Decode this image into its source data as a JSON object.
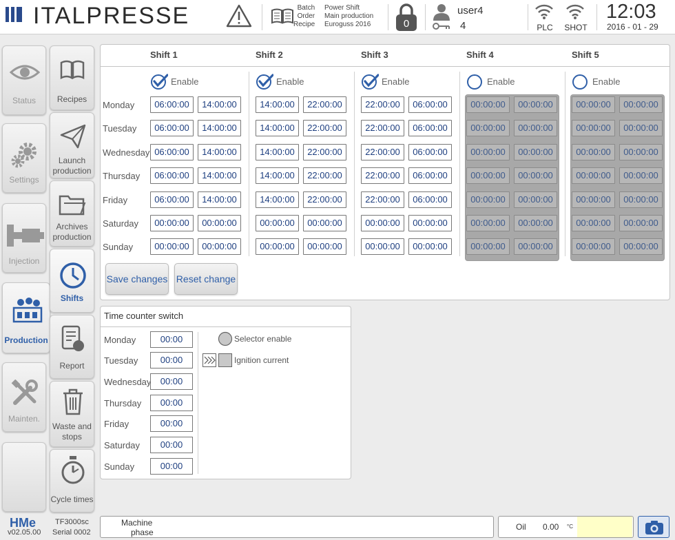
{
  "header": {
    "brand": "ITALPRESSE",
    "batch_label": "Batch",
    "batch_value": "Power Shift",
    "order_label": "Order",
    "order_value": "Main production",
    "recipe_label": "Recipe",
    "recipe_value": "Euroguss 2016",
    "lock_count": "0",
    "user_name": "user4",
    "user_level": "4",
    "plc_label": "PLC",
    "shot_label": "SHOT",
    "time": "12:03",
    "date": "2016 - 01 - 29"
  },
  "left_nav": [
    {
      "label": "Status",
      "icon": "eye-icon"
    },
    {
      "label": "Settings",
      "icon": "gears-icon"
    },
    {
      "label": "Injection",
      "icon": "injection-icon"
    },
    {
      "label": "Production",
      "icon": "factory-icon",
      "active": true
    },
    {
      "label": "Mainten.",
      "icon": "tools-icon"
    }
  ],
  "sub_nav": [
    {
      "label": "Recipes",
      "icon": "book-icon"
    },
    {
      "label": "Launch production",
      "label1": "Launch",
      "label2": "production",
      "icon": "paper-plane-icon"
    },
    {
      "label": "Archives production",
      "label1": "Archives",
      "label2": "production",
      "icon": "folder-icon"
    },
    {
      "label": "Shifts",
      "icon": "clock-icon",
      "active": true
    },
    {
      "label": "Report",
      "icon": "report-icon"
    },
    {
      "label": "Waste and stops",
      "label1": "Waste and",
      "label2": "stops",
      "icon": "trash-icon"
    },
    {
      "label": "Cycle times",
      "icon": "stopwatch-icon"
    }
  ],
  "shifts_table": {
    "enable_label": "Enable",
    "days": [
      "Monday",
      "Tuesday",
      "Wednesday",
      "Thursday",
      "Friday",
      "Saturday",
      "Sunday"
    ],
    "shifts": [
      {
        "name": "Shift 1",
        "enabled": true,
        "times": [
          [
            "06:00:00",
            "14:00:00"
          ],
          [
            "06:00:00",
            "14:00:00"
          ],
          [
            "06:00:00",
            "14:00:00"
          ],
          [
            "06:00:00",
            "14:00:00"
          ],
          [
            "06:00:00",
            "14:00:00"
          ],
          [
            "00:00:00",
            "00:00:00"
          ],
          [
            "00:00:00",
            "00:00:00"
          ]
        ]
      },
      {
        "name": "Shift 2",
        "enabled": true,
        "times": [
          [
            "14:00:00",
            "22:00:00"
          ],
          [
            "14:00:00",
            "22:00:00"
          ],
          [
            "14:00:00",
            "22:00:00"
          ],
          [
            "14:00:00",
            "22:00:00"
          ],
          [
            "14:00:00",
            "22:00:00"
          ],
          [
            "00:00:00",
            "00:00:00"
          ],
          [
            "00:00:00",
            "00:00:00"
          ]
        ]
      },
      {
        "name": "Shift 3",
        "enabled": true,
        "times": [
          [
            "22:00:00",
            "06:00:00"
          ],
          [
            "22:00:00",
            "06:00:00"
          ],
          [
            "22:00:00",
            "06:00:00"
          ],
          [
            "22:00:00",
            "06:00:00"
          ],
          [
            "22:00:00",
            "06:00:00"
          ],
          [
            "00:00:00",
            "00:00:00"
          ],
          [
            "00:00:00",
            "00:00:00"
          ]
        ]
      },
      {
        "name": "Shift 4",
        "enabled": false,
        "times": [
          [
            "00:00:00",
            "00:00:00"
          ],
          [
            "00:00:00",
            "00:00:00"
          ],
          [
            "00:00:00",
            "00:00:00"
          ],
          [
            "00:00:00",
            "00:00:00"
          ],
          [
            "00:00:00",
            "00:00:00"
          ],
          [
            "00:00:00",
            "00:00:00"
          ],
          [
            "00:00:00",
            "00:00:00"
          ]
        ]
      },
      {
        "name": "Shift 5",
        "enabled": false,
        "times": [
          [
            "00:00:00",
            "00:00:00"
          ],
          [
            "00:00:00",
            "00:00:00"
          ],
          [
            "00:00:00",
            "00:00:00"
          ],
          [
            "00:00:00",
            "00:00:00"
          ],
          [
            "00:00:00",
            "00:00:00"
          ],
          [
            "00:00:00",
            "00:00:00"
          ],
          [
            "00:00:00",
            "00:00:00"
          ]
        ]
      }
    ],
    "save_label": "Save changes",
    "reset_label": "Reset change"
  },
  "time_counter": {
    "title": "Time counter switch",
    "days": [
      "Monday",
      "Tuesday",
      "Wednesday",
      "Thursday",
      "Friday",
      "Saturday",
      "Sunday"
    ],
    "values": [
      "00:00",
      "00:00",
      "00:00",
      "00:00",
      "00:00",
      "00:00",
      "00:00"
    ],
    "legend_selector": "Selector enable",
    "legend_ignition": "Ignition current"
  },
  "footer": {
    "hme_logo": "HMe",
    "version": "v02.05.00",
    "model": "TF3000sc",
    "serial": "Serial 0002",
    "machine_phase_line1": "Machine",
    "machine_phase_line2": "phase",
    "oil_label": "Oil",
    "oil_value": "0.00",
    "oil_unit": "°C",
    "oil_indicator_color": "#ffffc8"
  },
  "colors": {
    "accent": "#2f5fa8",
    "brand": "#2a4a8c"
  }
}
